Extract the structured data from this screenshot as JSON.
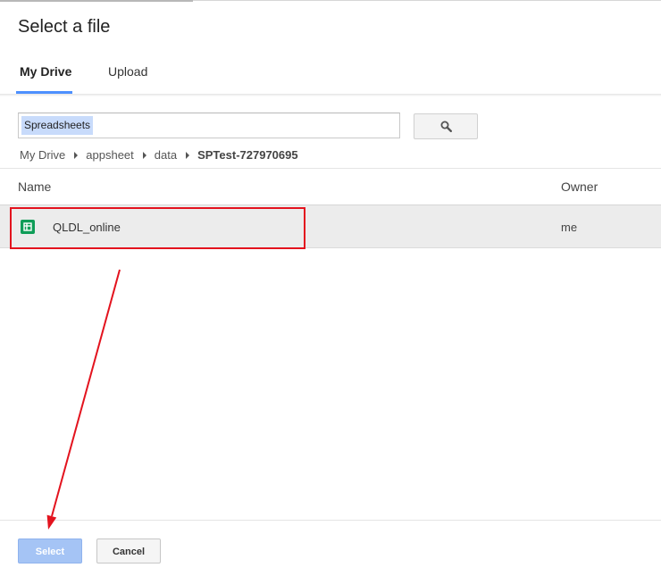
{
  "dialog": {
    "title": "Select a file"
  },
  "tabs": [
    {
      "label": "My Drive",
      "active": true
    },
    {
      "label": "Upload",
      "active": false
    }
  ],
  "search": {
    "value": "Spreadsheets",
    "button_icon": "search-icon"
  },
  "breadcrumb": [
    {
      "label": "My Drive"
    },
    {
      "label": "appsheet"
    },
    {
      "label": "data"
    },
    {
      "label": "SPTest-727970695",
      "current": true
    }
  ],
  "columns": {
    "name": "Name",
    "owner": "Owner"
  },
  "files": [
    {
      "name": "QLDL_online",
      "owner": "me",
      "icon": "google-sheets-icon",
      "selected": true
    }
  ],
  "footer": {
    "select_label": "Select",
    "cancel_label": "Cancel"
  },
  "colors": {
    "accent": "#4d90fe",
    "select_button": "#a5c4f5",
    "annotation": "#e3131e",
    "sheets_green": "#0f9d58"
  }
}
